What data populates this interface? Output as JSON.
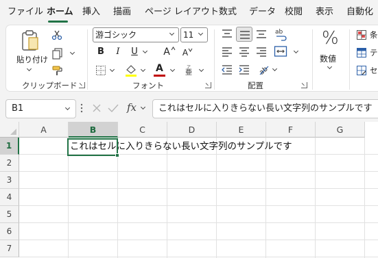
{
  "tabs": [
    "ファイル",
    "ホーム",
    "挿入",
    "描画",
    "ページ レイアウト",
    "数式",
    "データ",
    "校閲",
    "表示",
    "自動化"
  ],
  "active_tab": "ホーム",
  "ribbon": {
    "clipboard": {
      "paste_label": "貼り付け",
      "group_label": "クリップボード"
    },
    "font": {
      "font_name": "游ゴシック",
      "font_size": "11",
      "bold": "B",
      "italic": "I",
      "underline": "U",
      "grow": "A",
      "shrink": "A",
      "group_label": "フォント",
      "font_color": "#c00000",
      "highlight_color": "#ffff00"
    },
    "alignment": {
      "group_label": "配置"
    },
    "number": {
      "percent_symbol": "%",
      "label": "数値"
    },
    "styles": {
      "items": [
        "条",
        "テ",
        "セ"
      ]
    }
  },
  "formula_bar": {
    "name_box": "B1",
    "fx": "fx",
    "content": "これはセルに入りきらない長い文字列のサンプルです"
  },
  "grid": {
    "columns": [
      "A",
      "B",
      "C",
      "D",
      "E",
      "F",
      "G"
    ],
    "rows": [
      "1",
      "2",
      "3",
      "4",
      "5",
      "6",
      "7"
    ],
    "selected_column": "B",
    "selected_row": "1",
    "cell_B1": "これはセルに入りきらない長い文字列のサンプルです"
  },
  "accent_color": "#217346"
}
